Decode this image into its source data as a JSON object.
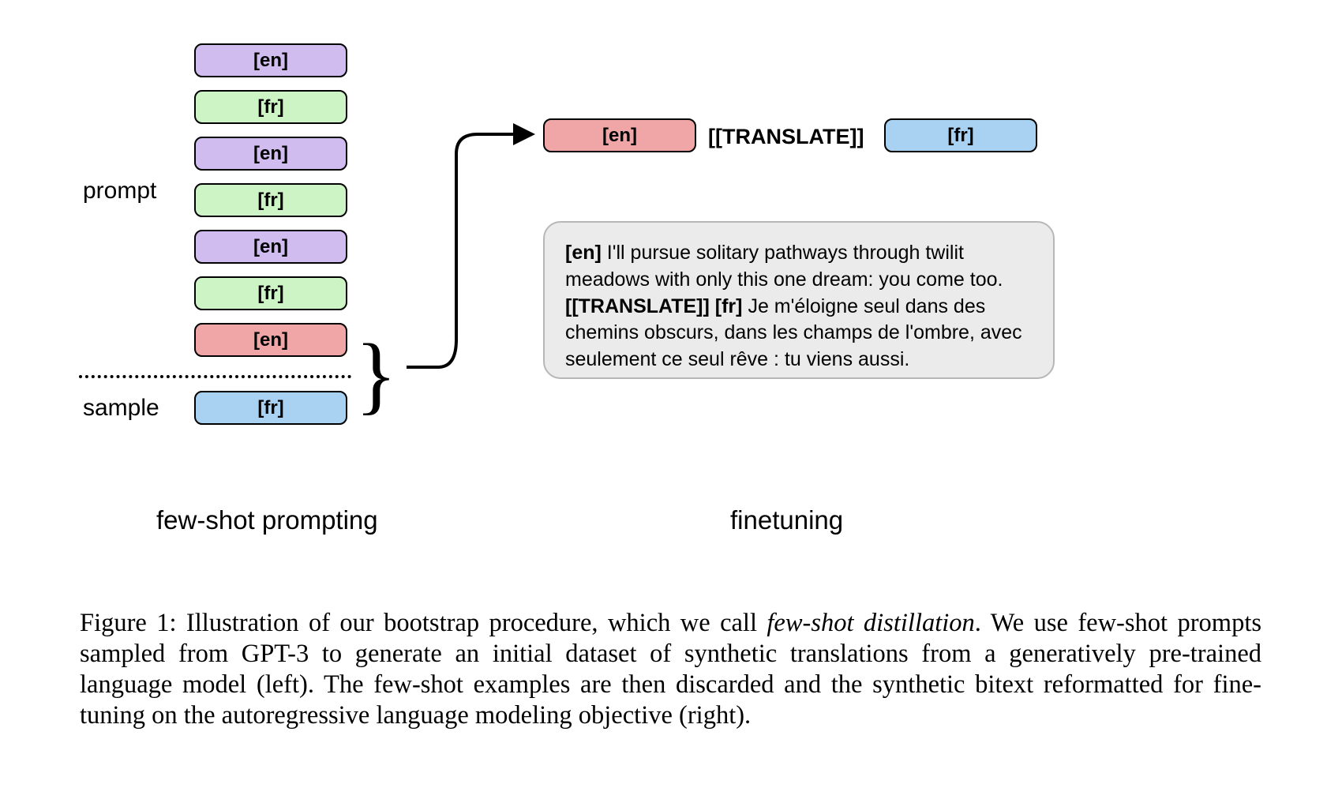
{
  "left_labels": {
    "prompt": "prompt",
    "sample": "sample"
  },
  "stack": [
    {
      "tag": "[en]",
      "color": "purple"
    },
    {
      "tag": "[fr]",
      "color": "green"
    },
    {
      "tag": "[en]",
      "color": "purple"
    },
    {
      "tag": "[fr]",
      "color": "green"
    },
    {
      "tag": "[en]",
      "color": "purple"
    },
    {
      "tag": "[fr]",
      "color": "green"
    },
    {
      "tag": "[en]",
      "color": "red"
    },
    {
      "tag": "[fr]",
      "color": "blue"
    }
  ],
  "right_tokens": {
    "en": "[en]",
    "translate": "[[TRANSLATE]]",
    "fr": "[fr]"
  },
  "translation_box": {
    "en_tag": "[en]",
    "en_text": " I'll pursue solitary pathways through twilit meadows with only this one dream: you come too. ",
    "translate_tag": "[[TRANSLATE]] ",
    "fr_tag": "[fr]",
    "fr_text": " Je m'éloigne seul dans des chemins obscurs, dans les champs de l'ombre, avec seulement ce seul rêve : tu viens aussi."
  },
  "section_labels": {
    "left": "few-shot prompting",
    "right": "finetuning"
  },
  "caption": {
    "prefix": "Figure 1:  Illustration of our bootstrap procedure, which we call ",
    "italic": "few-shot distillation",
    "suffix": ". We use few-shot prompts sampled from GPT-3 to generate an initial dataset of synthetic translations from a generatively pre-trained language model (left). The few-shot examples are then discarded and the synthetic bitext reformatted for fine-tuning on the autoregressive language modeling objective (right)."
  }
}
